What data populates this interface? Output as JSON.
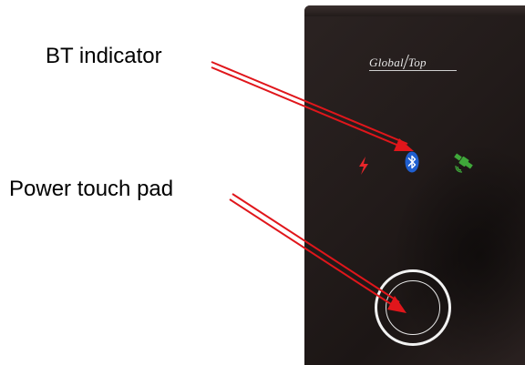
{
  "annotations": {
    "bt_indicator_label": "BT indicator",
    "power_touch_pad_label": "Power touch pad"
  },
  "device": {
    "logo_text_left": "Global",
    "logo_text_right": "Top",
    "indicators": [
      "power-icon",
      "bluetooth-icon",
      "gps-satellite-icon"
    ]
  },
  "colors": {
    "arrow": "#e0161b",
    "power_indicator": "#e8262a",
    "bt_indicator": "#1f5fd0",
    "gps_indicator": "#3fa83a",
    "device_body": "#221b1a"
  }
}
